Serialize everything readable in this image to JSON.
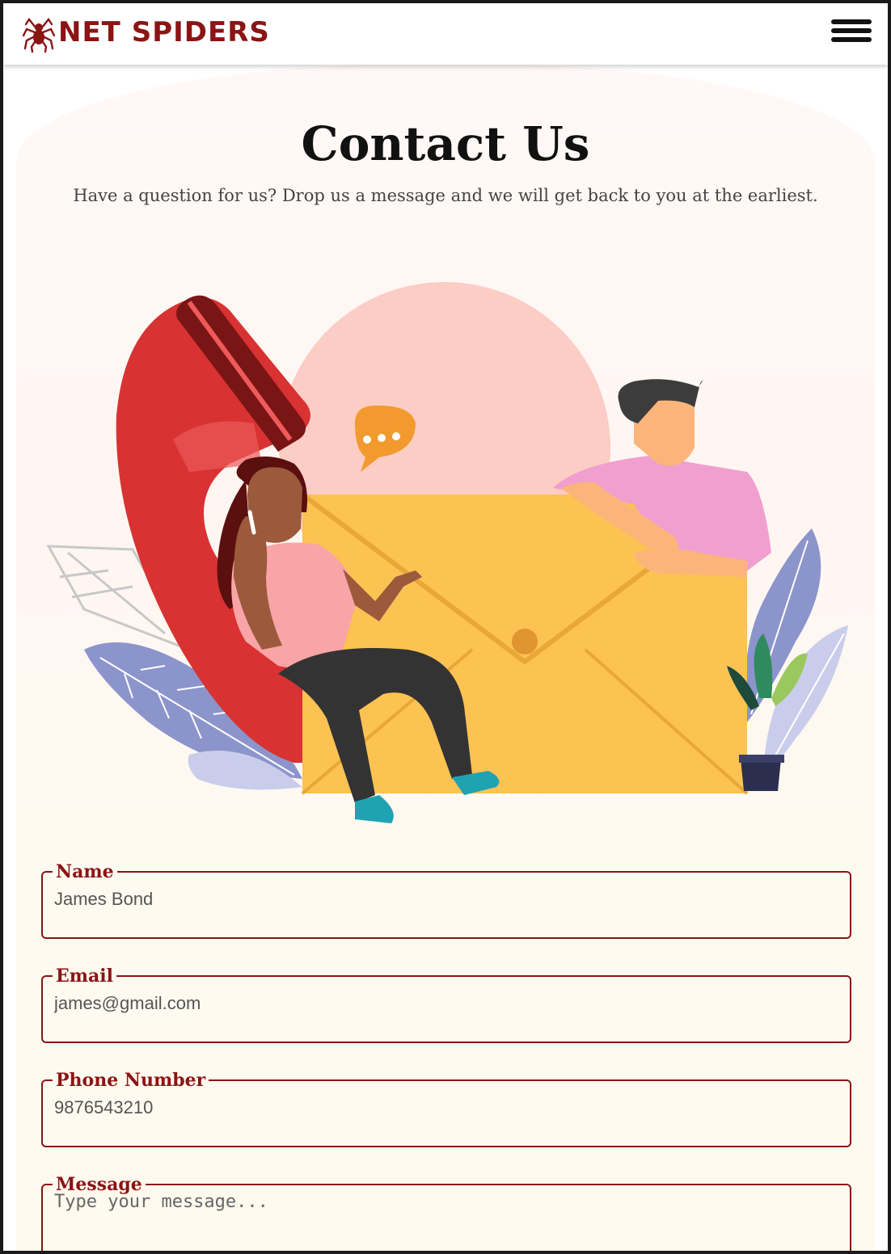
{
  "brand": {
    "name": "NET SPIDERS",
    "color": "#8b1414"
  },
  "header": {
    "menu_icon": "hamburger-menu-icon"
  },
  "page": {
    "title": "Contact Us",
    "subtitle": "Have a question for us? Drop us a message and we will get back to you at the earliest."
  },
  "form": {
    "name": {
      "label": "Name",
      "value": "James Bond"
    },
    "email": {
      "label": "Email",
      "value": "james@gmail.com"
    },
    "phone": {
      "label": "Phone Number",
      "value": "9876543210"
    },
    "message": {
      "label": "Message",
      "placeholder": "Type your message..."
    }
  },
  "illustration": {
    "icon": "contact-illustration",
    "colors": {
      "phone": "#d83232",
      "envelope": "#fcc252",
      "circle": "#fccdc5",
      "leaf": "#8c94cc"
    }
  }
}
